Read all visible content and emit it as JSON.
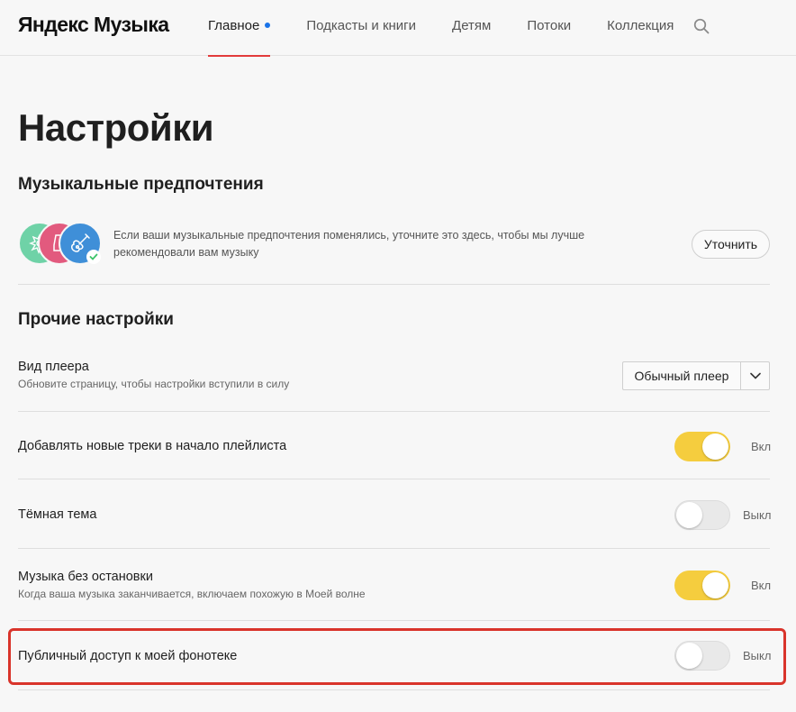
{
  "header": {
    "logo": "Яндекс Музыка",
    "nav": [
      {
        "label": "Главное",
        "active": true
      },
      {
        "label": "Подкасты и книги"
      },
      {
        "label": "Детям"
      },
      {
        "label": "Потоки"
      },
      {
        "label": "Коллекция"
      }
    ],
    "search_icon": "search-icon"
  },
  "page": {
    "title": "Настройки"
  },
  "music_prefs": {
    "title": "Музыкальные предпочтения",
    "description": "Если ваши музыкальные предпочтения поменялись, уточните это здесь, чтобы мы лучше рекомендовали вам музыку",
    "button": "Уточнить",
    "avatar_icons": [
      "flower-icon",
      "boot-icon",
      "guitar-icon"
    ]
  },
  "other": {
    "title": "Прочие настройки",
    "player_view": {
      "label": "Вид плеера",
      "sub": "Обновите страницу, чтобы настройки вступили в силу",
      "value": "Обычный плеер"
    },
    "new_tracks": {
      "label": "Добавлять новые треки в начало плейлиста",
      "state": "Вкл"
    },
    "dark_theme": {
      "label": "Тёмная тема",
      "state": "Выкл"
    },
    "nonstop": {
      "label": "Музыка без остановки",
      "sub": "Когда ваша музыка заканчивается, включаем похожую в Моей волне",
      "state": "Вкл"
    },
    "public_access": {
      "label": "Публичный доступ к моей фонотеке",
      "state": "Выкл"
    }
  },
  "colors": {
    "accent_yellow": "#f5cd3e",
    "nav_active_underline": "#e23b3b",
    "highlight_border": "#d9342b",
    "dot_blue": "#1a73e8"
  }
}
